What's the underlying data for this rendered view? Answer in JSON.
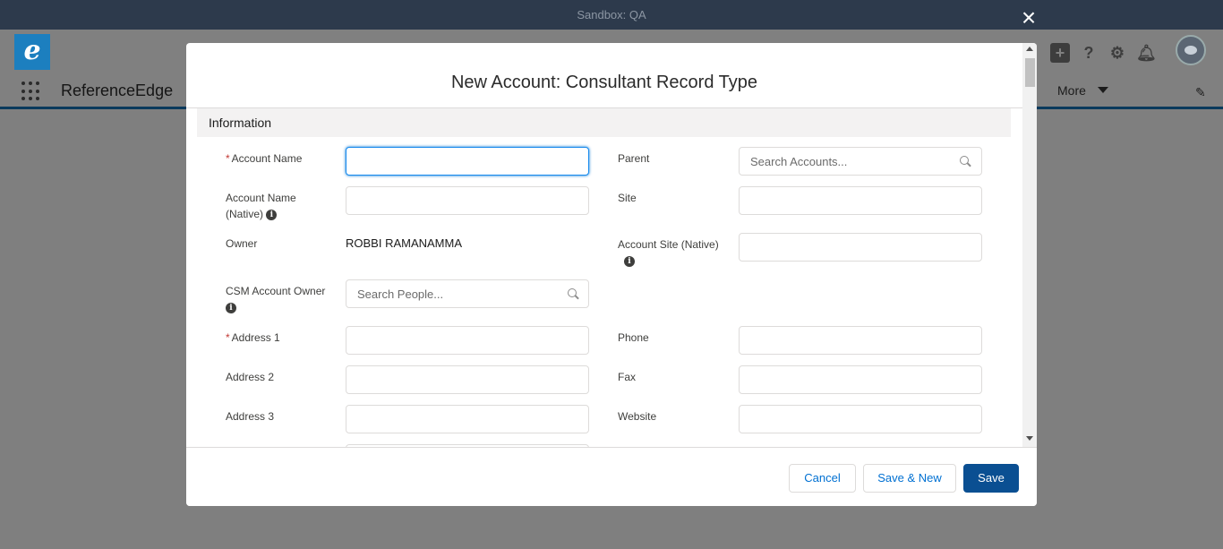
{
  "sandbox_bar": {
    "label": "Sandbox: QA"
  },
  "app": {
    "name": "ReferenceEdge",
    "logo_letter": "e",
    "more_label": "More"
  },
  "modal": {
    "title": "New Account: Consultant Record Type",
    "close_icon": "×",
    "section": "Information",
    "fields": {
      "account_name": {
        "label": "Account Name",
        "required": true,
        "value": ""
      },
      "account_name_native": {
        "label": "Account Name (Native)",
        "value": ""
      },
      "owner": {
        "label": "Owner",
        "value": "ROBBI RAMANAMMA"
      },
      "csm_account_owner": {
        "label": "CSM Account Owner",
        "placeholder": "Search People..."
      },
      "address_1": {
        "label": "Address 1",
        "required": true,
        "value": ""
      },
      "address_2": {
        "label": "Address 2",
        "value": ""
      },
      "address_3": {
        "label": "Address 3",
        "value": ""
      },
      "parent": {
        "label": "Parent",
        "placeholder": "Search Accounts..."
      },
      "site": {
        "label": "Site",
        "value": ""
      },
      "account_site_native": {
        "label": "Account Site (Native)",
        "value": ""
      },
      "phone": {
        "label": "Phone",
        "value": ""
      },
      "fax": {
        "label": "Fax",
        "value": ""
      },
      "website": {
        "label": "Website",
        "value": ""
      }
    },
    "buttons": {
      "cancel": "Cancel",
      "save_new": "Save & New",
      "save": "Save"
    }
  },
  "colors": {
    "brand": "#0a4f92",
    "required": "#c23934",
    "focus": "#1589ee"
  }
}
